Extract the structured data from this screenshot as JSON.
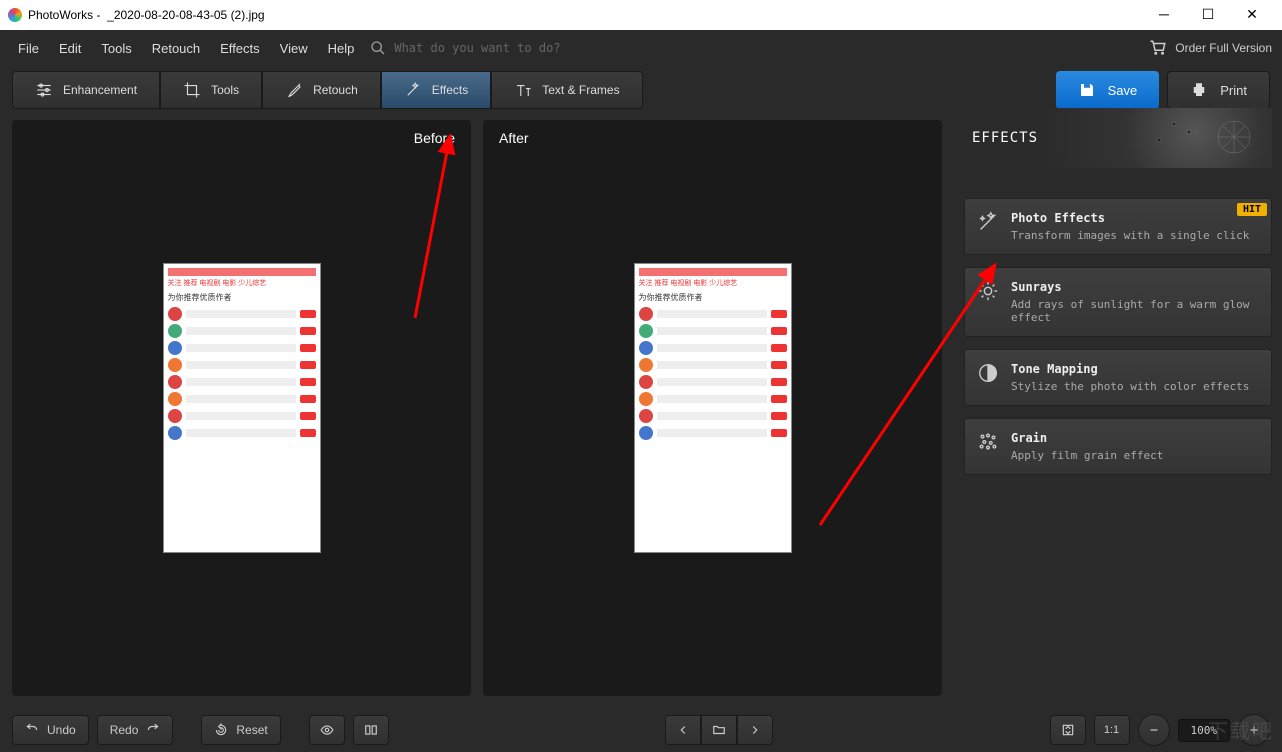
{
  "window": {
    "app": "PhotoWorks",
    "file": "_2020-08-20-08-43-05 (2).jpg"
  },
  "menu": {
    "items": [
      "File",
      "Edit",
      "Tools",
      "Retouch",
      "Effects",
      "View",
      "Help"
    ],
    "search_hint": "What do you want to do?",
    "order": "Order Full Version"
  },
  "tabs": {
    "enhancement": "Enhancement",
    "tools": "Tools",
    "retouch": "Retouch",
    "effects": "Effects",
    "text": "Text & Frames",
    "active": "effects"
  },
  "actions": {
    "save": "Save",
    "print": "Print"
  },
  "compare": {
    "before": "Before",
    "after": "After"
  },
  "sidebar": {
    "title": "EFFECTS",
    "items": [
      {
        "title": "Photo Effects",
        "desc": "Transform images with a single click",
        "badge": "HIT",
        "icon": "wand"
      },
      {
        "title": "Sunrays",
        "desc": "Add rays of sunlight for a warm glow effect",
        "icon": "sun"
      },
      {
        "title": "Tone Mapping",
        "desc": "Stylize the photo with color effects",
        "icon": "contrast"
      },
      {
        "title": "Grain",
        "desc": "Apply film grain effect",
        "icon": "dots"
      }
    ]
  },
  "bottom": {
    "undo": "Undo",
    "redo": "Redo",
    "reset": "Reset",
    "zoom": "100%",
    "ratio": "1:1"
  },
  "watermark": "下载吧"
}
